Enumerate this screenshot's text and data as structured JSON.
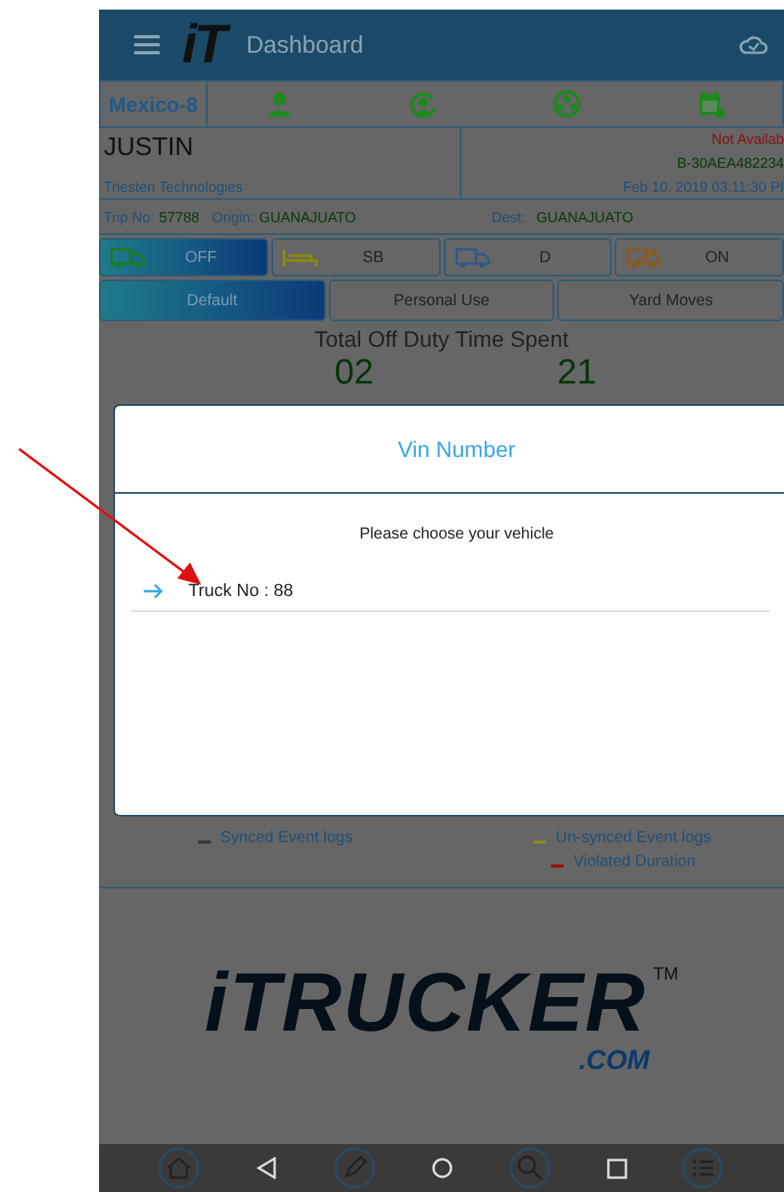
{
  "header": {
    "logo": "iT",
    "title": "Dashboard"
  },
  "status_row": {
    "label": "Mexico-8"
  },
  "driver": {
    "name": "JUSTIN",
    "company": "Triesten Technologies",
    "availability": "Not Availab",
    "device": "B-30AEA482234",
    "datetime": "Feb 10, 2019 03:11:30 PI"
  },
  "trip": {
    "trip_label": "Trip No:",
    "trip_no": "57788",
    "origin_label": "Origin:",
    "origin": "GUANAJUATO",
    "dest_label": "Dest:",
    "dest": "GUANAJUATO"
  },
  "duty_statuses": [
    {
      "label": "OFF",
      "kind": "off",
      "selected": true
    },
    {
      "label": "SB",
      "kind": "sleeper",
      "selected": false
    },
    {
      "label": "D",
      "kind": "driving",
      "selected": false
    },
    {
      "label": "ON",
      "kind": "on",
      "selected": false
    }
  ],
  "modes": [
    {
      "label": "Default",
      "selected": true
    },
    {
      "label": "Personal Use",
      "selected": false
    },
    {
      "label": "Yard Moves",
      "selected": false
    }
  ],
  "summary": {
    "title": "Total Off Duty Time Spent",
    "values": [
      "02",
      "21"
    ]
  },
  "legend": [
    {
      "label": "Synced Event logs",
      "color": "#3a3a3a"
    },
    {
      "label": "Un-synced Event logs",
      "color": "#8a8a20"
    },
    {
      "label": "Violated Duration",
      "color": "#a01010"
    }
  ],
  "logo": {
    "word": "iTRUCKER",
    "mark": "TM",
    "domain": ".COM"
  },
  "dialog": {
    "title": "Vin Number",
    "prompt": "Please choose your vehicle",
    "items": [
      {
        "label": "Truck No : 88"
      }
    ]
  }
}
